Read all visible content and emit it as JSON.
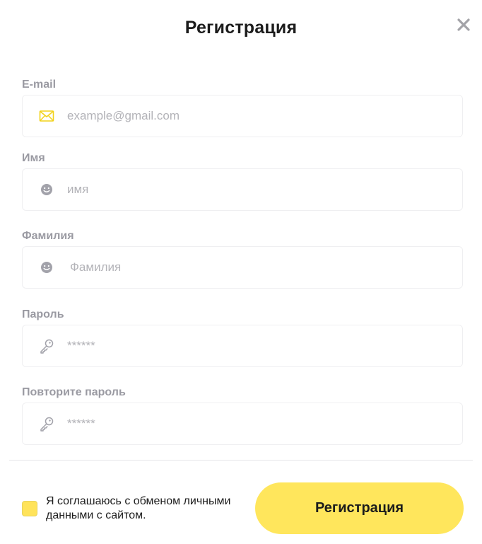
{
  "dialog": {
    "title": "Регистрация",
    "close_label": "✕"
  },
  "fields": {
    "email": {
      "label": "E-mail",
      "value": "",
      "placeholder": "example@gmail.com",
      "icon": "envelope-icon"
    },
    "first_name": {
      "label": "Имя",
      "value": "",
      "placeholder": "имя",
      "icon": "smiley-icon"
    },
    "last_name": {
      "label": "Фамилия",
      "value": "",
      "placeholder": "Фамилия",
      "icon": "smiley-icon"
    },
    "password": {
      "label": "Пароль",
      "value": "",
      "placeholder": "******",
      "icon": "key-icon"
    },
    "password_repeat": {
      "label": "Повторите пароль",
      "value": "",
      "placeholder": "******",
      "icon": "key-icon"
    }
  },
  "agreement": {
    "checked": true,
    "text": "Я соглашаюсь с обменом личными данными с сайтом."
  },
  "submit": {
    "label": "Регистрация"
  },
  "colors": {
    "accent": "#ffe65c",
    "label": "#9a9aa2",
    "placeholder": "#b3b3b8",
    "envelope_icon": "#f2d21a",
    "face_icon": "#a2a2aa"
  }
}
